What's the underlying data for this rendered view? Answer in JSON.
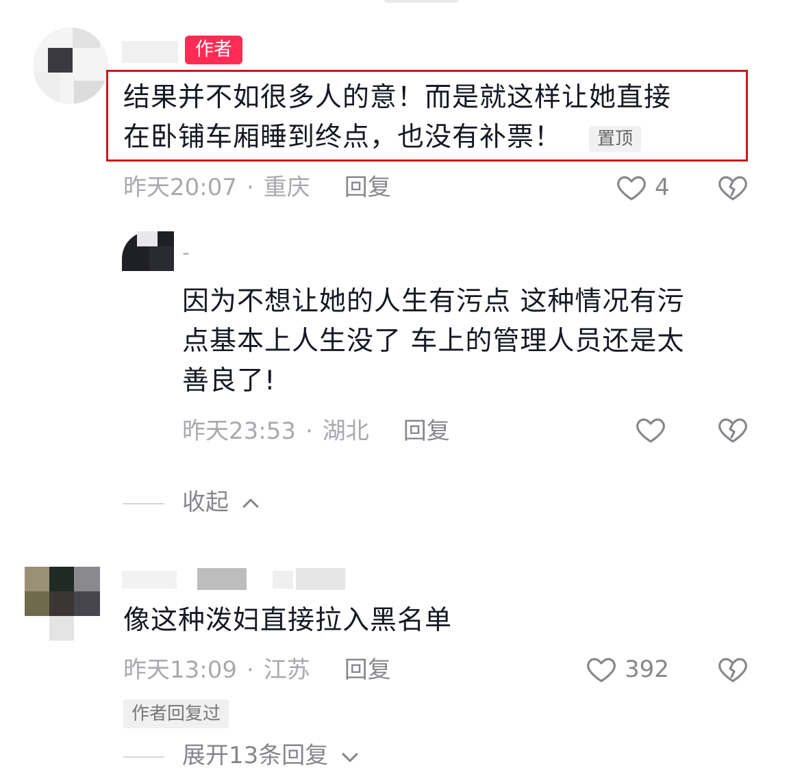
{
  "comment1": {
    "author_badge": "作者",
    "text_line1": "结果并不如很多人的意！而是就这样让她直接",
    "text_line2": "在卧铺车厢睡到终点，也没有补票！",
    "pin_label": "置顶",
    "time": "昨天20:07",
    "location": "重庆",
    "reply_label": "回复",
    "likes": "4"
  },
  "reply1": {
    "name_mark": "-",
    "text_line1": "因为不想让她的人生有污点 这种情况有污",
    "text_line2": "点基本上人生没了 车上的管理人员还是太",
    "text_line3": "善良了!",
    "time": "昨天23:53",
    "location": "湖北",
    "reply_label": "回复",
    "collapse_label": "收起"
  },
  "comment2": {
    "text": "像这种泼妇直接拉入黑名单",
    "time": "昨天13:09",
    "location": "江苏",
    "reply_label": "回复",
    "likes": "392",
    "author_replied_badge": "作者回复过",
    "expand_label": "展开13条回复"
  },
  "separator": "·",
  "icons": [
    "heart-icon",
    "broken-heart-icon",
    "chevron-up-icon",
    "chevron-down-icon"
  ],
  "colors": {
    "author_badge": "#fe2c55",
    "highlight_border": "#c41a1a",
    "meta_gray": "#a8a9ad"
  }
}
